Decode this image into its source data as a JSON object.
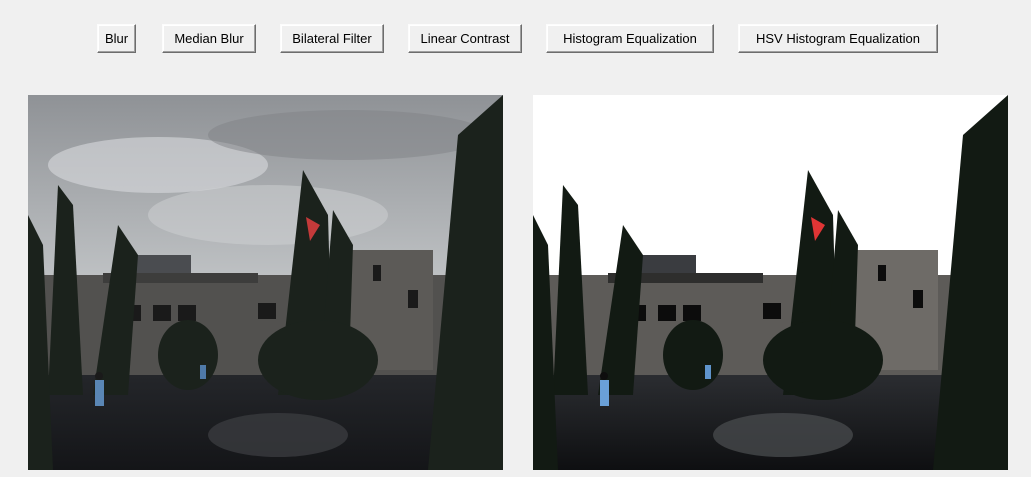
{
  "toolbar": {
    "buttons": [
      {
        "label": "Blur"
      },
      {
        "label": "Median Blur"
      },
      {
        "label": "Bilateral Filter"
      },
      {
        "label": "Linear Contrast"
      },
      {
        "label": "Histogram Equalization"
      },
      {
        "label": "HSV Histogram Equalization"
      }
    ]
  },
  "images": {
    "original": {
      "sky_top": "#8f9296",
      "sky_bottom": "#b9bcbf"
    },
    "processed": {
      "sky_top": "#ffffff",
      "sky_bottom": "#ffffff"
    }
  }
}
